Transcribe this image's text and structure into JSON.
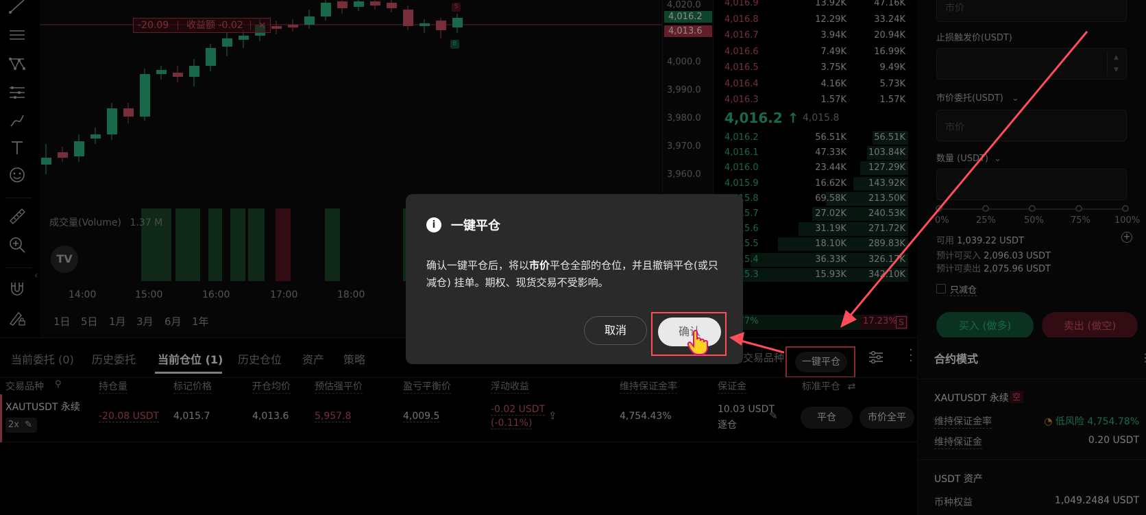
{
  "chart": {
    "price_ticks": [
      "4,020.0",
      "4,000.0",
      "3,990.0",
      "3,980.0",
      "3,970.0",
      "3,960.0"
    ],
    "price_tag_green": "4,016.2",
    "price_tag_red": "4,013.6",
    "pnl_value": "-20.09",
    "pnl_label": "收益额 -0.02",
    "pnl_close": "×",
    "volume_label": "成交量(Volume)",
    "volume_value": "1.37 M",
    "time_ticks": [
      "14:00",
      "15:00",
      "16:00",
      "17:00",
      "18:00"
    ],
    "ranges": [
      "1日",
      "5日",
      "1月",
      "3月",
      "6月",
      "1年"
    ],
    "marker_sell": "S",
    "marker_buy": "B",
    "collapse": "‹"
  },
  "orderbook": {
    "asks": [
      {
        "price": "4,016.9",
        "size": "13.92K",
        "total": "47.16K"
      },
      {
        "price": "4,016.8",
        "size": "12.29K",
        "total": "33.24K"
      },
      {
        "price": "4,016.7",
        "size": "3.94K",
        "total": "20.94K"
      },
      {
        "price": "4,016.6",
        "size": "7.49K",
        "total": "16.99K"
      },
      {
        "price": "4,016.5",
        "size": "3.75K",
        "total": "9.49K"
      },
      {
        "price": "4,016.4",
        "size": "4.16K",
        "total": "5.73K"
      },
      {
        "price": "4,016.3",
        "size": "1.57K",
        "total": "1.57K"
      }
    ],
    "last_price": "4,016.2 ↑",
    "mark_price": "4,015.8",
    "bids": [
      {
        "price": "4,016.2",
        "size": "56.51K",
        "total": "56.51K"
      },
      {
        "price": "4,016.1",
        "size": "47.33K",
        "total": "103.84K"
      },
      {
        "price": "4,016.0",
        "size": "23.44K",
        "total": "127.29K"
      },
      {
        "price": "4,015.9",
        "size": "16.62K",
        "total": "143.92K"
      },
      {
        "price": "4,015.8",
        "size": "69.58K",
        "total": "213.50K"
      },
      {
        "price": "4,015.7",
        "size": "27.02K",
        "total": "240.53K"
      },
      {
        "price": "4,015.6",
        "size": "31.19K",
        "total": "271.72K"
      },
      {
        "price": "4,015.5",
        "size": "18.10K",
        "total": "289.83K"
      },
      {
        "price": "4,015.4",
        "size": "36.33K",
        "total": "326.17K"
      },
      {
        "price": "4,015.3",
        "size": "15.93K",
        "total": "342.10K"
      }
    ],
    "buy_ratio": "82.77%",
    "sell_ratio": "17.23%",
    "sell_letter": "S"
  },
  "trade": {
    "top_input_placeholder": "市价",
    "stop_label": "止损触发价(USDT)",
    "market_label": "市价委托(USDT)",
    "market_placeholder": "市价",
    "qty_label": "数量 (USDT)",
    "slider": [
      "0%",
      "25%",
      "50%",
      "75%",
      "100%"
    ],
    "available_label": "可用",
    "available_value": "1,039.22 USDT",
    "est_buy_label": "预计可买入",
    "est_buy_value": "2,096.03 USDT",
    "est_sell_label": "预计可卖出",
    "est_sell_value": "2,075.96 USDT",
    "reduce_only": "只减仓",
    "buy_label": "买入 (做多)",
    "sell_label": "卖出 (做空)"
  },
  "bottom": {
    "tabs": [
      "当前委托 (0)",
      "历史委托",
      "当前仓位 (1)",
      "历史仓位",
      "资产",
      "策略"
    ],
    "current_symbol_toggle": "当前交易品种",
    "close_all_label": "一键平仓",
    "headers": [
      "交易品种",
      "持仓量",
      "标记价格",
      "开仓均价",
      "预估强平价",
      "盈亏平衡价",
      "浮动收益",
      "维持保证金率",
      "保证金",
      "标准平仓"
    ],
    "position": {
      "symbol": "XAUTUSDT 永续",
      "leverage": "2x",
      "size": "-20.08 USDT",
      "mark": "4,015.7",
      "entry": "4,013.6",
      "liq": "5,957.8",
      "breakeven": "4,009.5",
      "pnl": "-0.02 USDT",
      "pnl_pct": "(-0.11%)",
      "margin_rate": "4,754.43%",
      "margin": "10.03 USDT",
      "margin_mode": "逐仓",
      "close_btn": "平仓",
      "market_close_btn": "市价全平"
    }
  },
  "contract": {
    "title": "合约模式",
    "symbol": "XAUTUSDT 永续",
    "side_badge": "空",
    "mm_rate_label": "维持保证金率",
    "risk_label": "低风险",
    "mm_rate_value": "4,754.78%",
    "mm_label": "维持保证金",
    "mm_value": "0.20 USDT",
    "asset_title": "USDT 资产",
    "equity_label": "币种权益",
    "equity_value": "1,049.2484 USDT"
  },
  "dialog": {
    "icon": "i",
    "title": "一键平仓",
    "body_before": "确认一键平仓后，将以",
    "body_bold": "市价",
    "body_after": "平仓全部的仓位，并且撤销平仓(或只减仓) 挂单。期权、现货交易不受影响。",
    "cancel_label": "取消",
    "confirm_label": "确认"
  },
  "colors": {
    "up": "#2ebd85",
    "down": "#d85767",
    "highlight": "#ff4d5a",
    "panel": "#2a2a2a"
  }
}
